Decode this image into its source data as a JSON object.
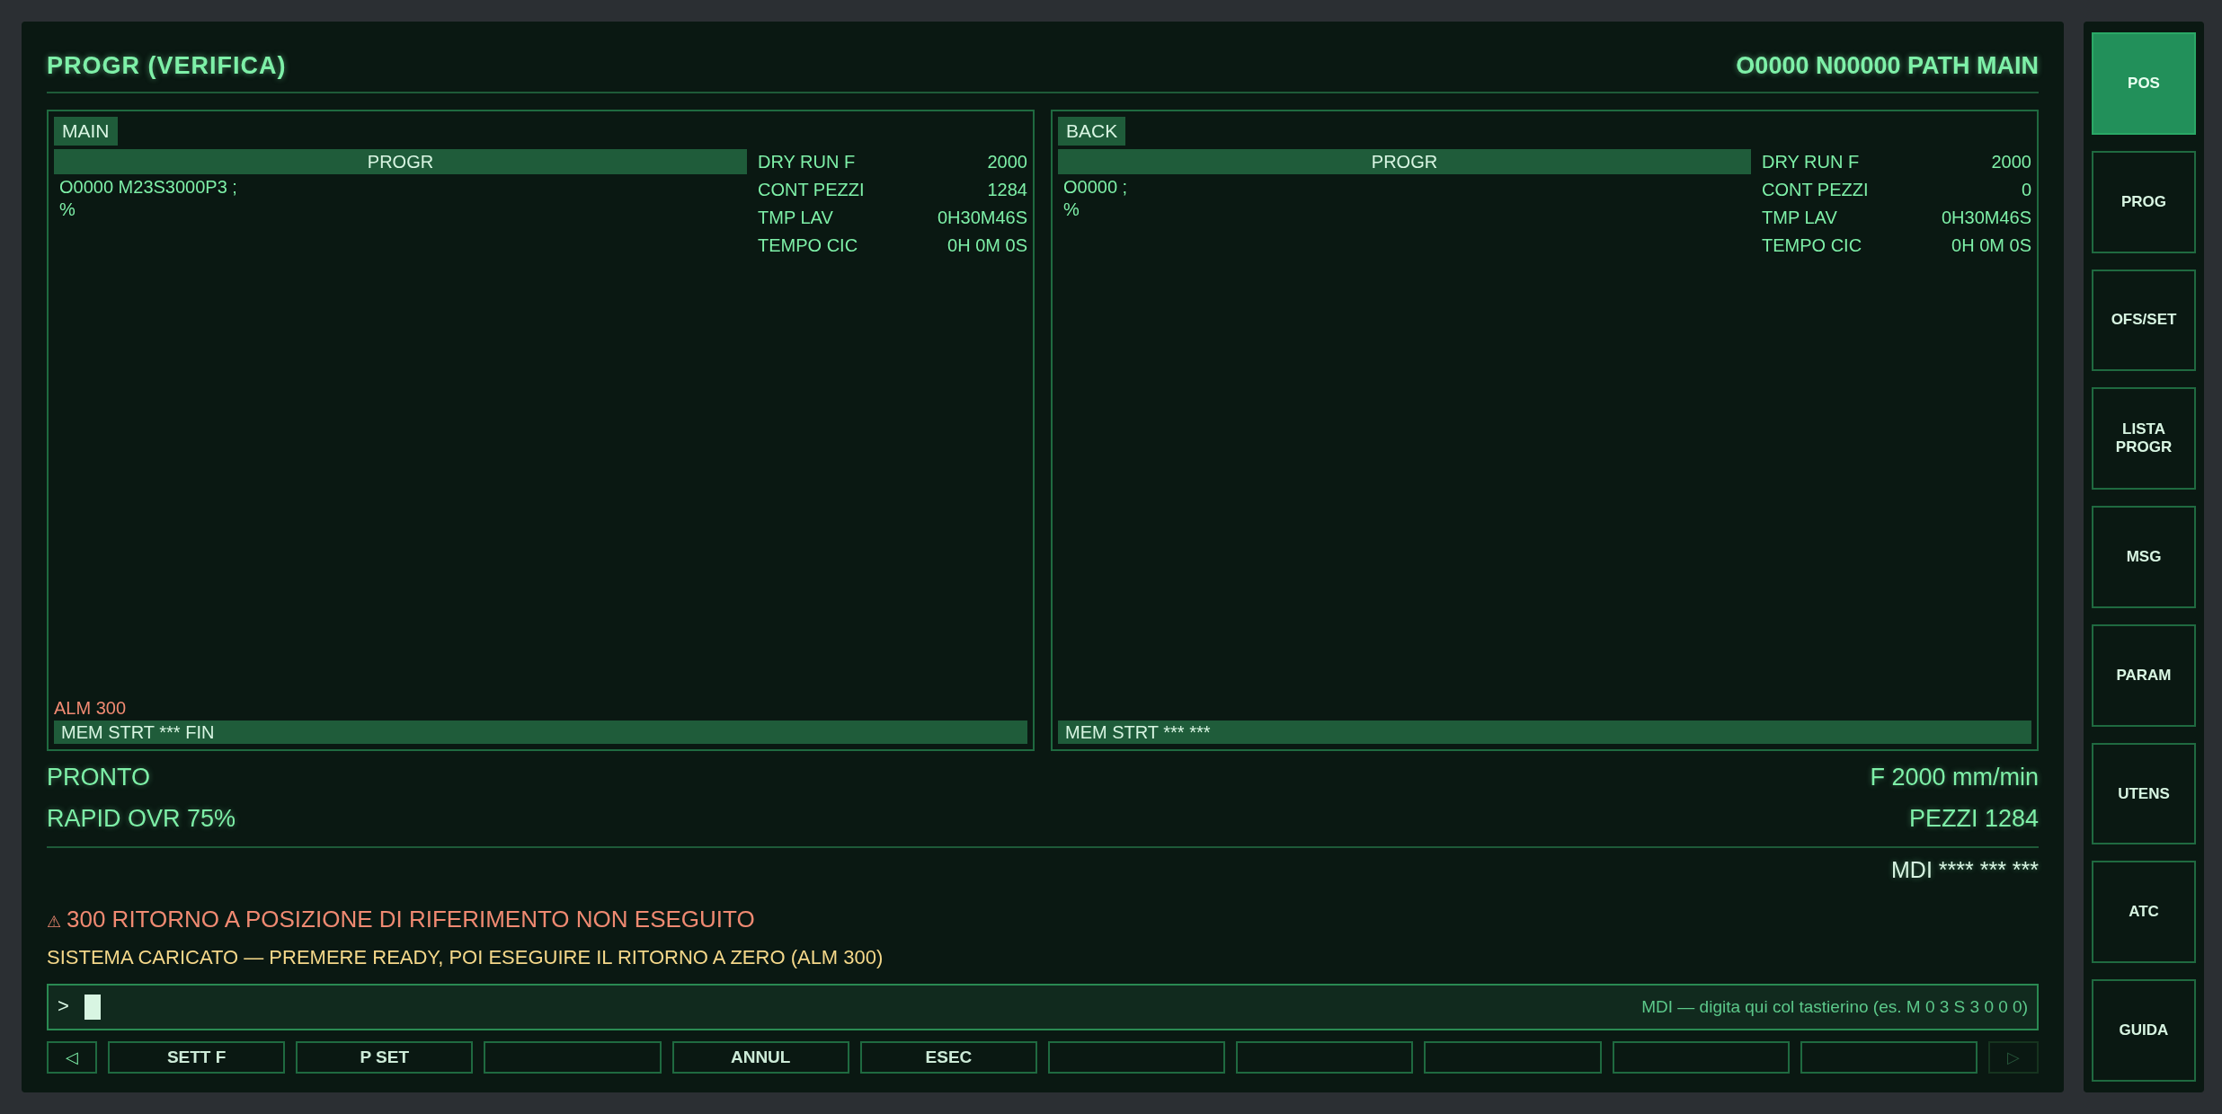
{
  "header": {
    "title": "PROGR (VERIFICA)",
    "program_info": "O0000 N00000 PATH MAIN"
  },
  "panels": [
    {
      "tab": "MAIN",
      "header": "PROGR",
      "lines": [
        "O0000 M23S3000P3 ;",
        "%"
      ],
      "info": [
        {
          "label": "DRY RUN F",
          "value": "2000"
        },
        {
          "label": "CONT PEZZI",
          "value": "1284"
        },
        {
          "label": "TMP LAV",
          "value": "0H30M46S"
        },
        {
          "label": "TEMPO CIC",
          "value": "0H 0M 0S"
        }
      ],
      "alarm": "ALM 300",
      "status": "MEM STRT *** FIN"
    },
    {
      "tab": "BACK",
      "header": "PROGR",
      "lines": [
        "O0000 ;",
        "%"
      ],
      "info": [
        {
          "label": "DRY RUN F",
          "value": "2000"
        },
        {
          "label": "CONT PEZZI",
          "value": "0"
        },
        {
          "label": "TMP LAV",
          "value": "0H30M46S"
        },
        {
          "label": "TEMPO CIC",
          "value": "0H 0M 0S"
        }
      ],
      "status": "MEM STRT *** ***"
    }
  ],
  "status": {
    "state": "PRONTO",
    "rapid": "RAPID OVR 75%",
    "feed": "F 2000 mm/min",
    "parts": "PEZZI 1284",
    "mode": "MDI **** *** ***"
  },
  "alarm": {
    "icon": "⚠",
    "text": "300 RITORNO A POSIZIONE DI RIFERIMENTO NON ESEGUITO"
  },
  "hint": "SISTEMA CARICATO — PREMERE READY, POI ESEGUIRE IL RITORNO A ZERO (ALM 300)",
  "mdi_input": {
    "prompt": ">",
    "placeholder": "MDI — digita qui col tastierino (es. M 0 3 S 3 0 0 0)"
  },
  "softkeys": {
    "prev": {
      "label": "◁",
      "disabled": false
    },
    "next": {
      "label": "▷",
      "disabled": true
    },
    "keys": [
      {
        "kind": "key",
        "label": "SETT F"
      },
      {
        "kind": "key",
        "label": "P SET"
      },
      {
        "kind": "blank"
      },
      {
        "kind": "key",
        "label": "ANNUL"
      },
      {
        "kind": "key",
        "label": "ESEC"
      },
      {
        "kind": "blank"
      },
      {
        "kind": "blank"
      },
      {
        "kind": "blank"
      },
      {
        "kind": "blank"
      },
      {
        "kind": "blank"
      }
    ]
  },
  "sidebar": {
    "items": [
      {
        "label": "POS",
        "selected": true
      },
      {
        "label": "PROG",
        "selected": false
      },
      {
        "label": "OFS/SET",
        "selected": false
      },
      {
        "label": "LISTA PROGR",
        "selected": false
      },
      {
        "label": "MSG",
        "selected": false
      },
      {
        "label": "PARAM",
        "selected": false
      },
      {
        "label": "UTENS",
        "selected": false
      },
      {
        "label": "ATC",
        "selected": false
      },
      {
        "label": "GUIDA",
        "selected": false
      }
    ]
  }
}
